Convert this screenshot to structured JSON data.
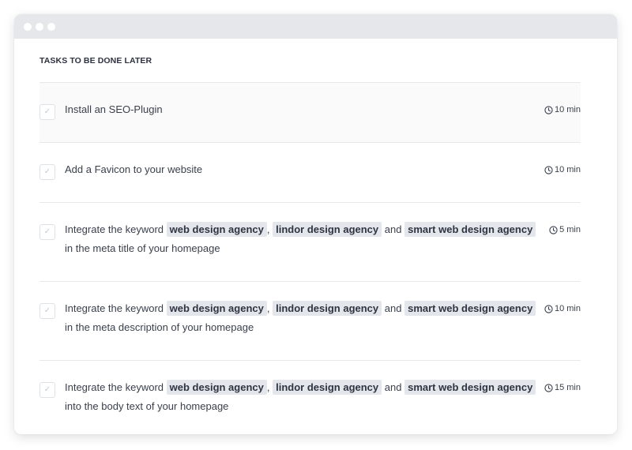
{
  "section_title": "TASKS TO BE DONE LATER",
  "tasks": [
    {
      "text": "Install an SEO-Plugin",
      "time": "10 min"
    },
    {
      "text": "Add a Favicon to your website",
      "time": "10 min"
    },
    {
      "prefix": "Integrate the keyword",
      "kw1": "web design agency",
      "sep": ",",
      "kw2": "lindor design agency",
      "and": "and",
      "kw3": "smart web design agency",
      "suffix": "in the meta title of your homepage",
      "time": "5 min"
    },
    {
      "prefix": "Integrate the keyword",
      "kw1": "web design agency",
      "sep": ",",
      "kw2": "lindor design agency",
      "and": "and",
      "kw3": "smart web design agency",
      "suffix": "in the meta description of your homepage",
      "time": "10 min"
    },
    {
      "prefix": "Integrate the keyword",
      "kw1": "web design agency",
      "sep": ",",
      "kw2": "lindor design agency",
      "and": "and",
      "kw3": "smart web design agency",
      "suffix": "into the body text of your homepage",
      "time": "15 min"
    }
  ],
  "icons": {
    "checkbox": "checkmark-icon",
    "time": "clock-icon"
  },
  "colors": {
    "titlebar": "#e5e7ea",
    "keyword_bg": "#e3e6eb",
    "divider": "#e6e8ec"
  }
}
